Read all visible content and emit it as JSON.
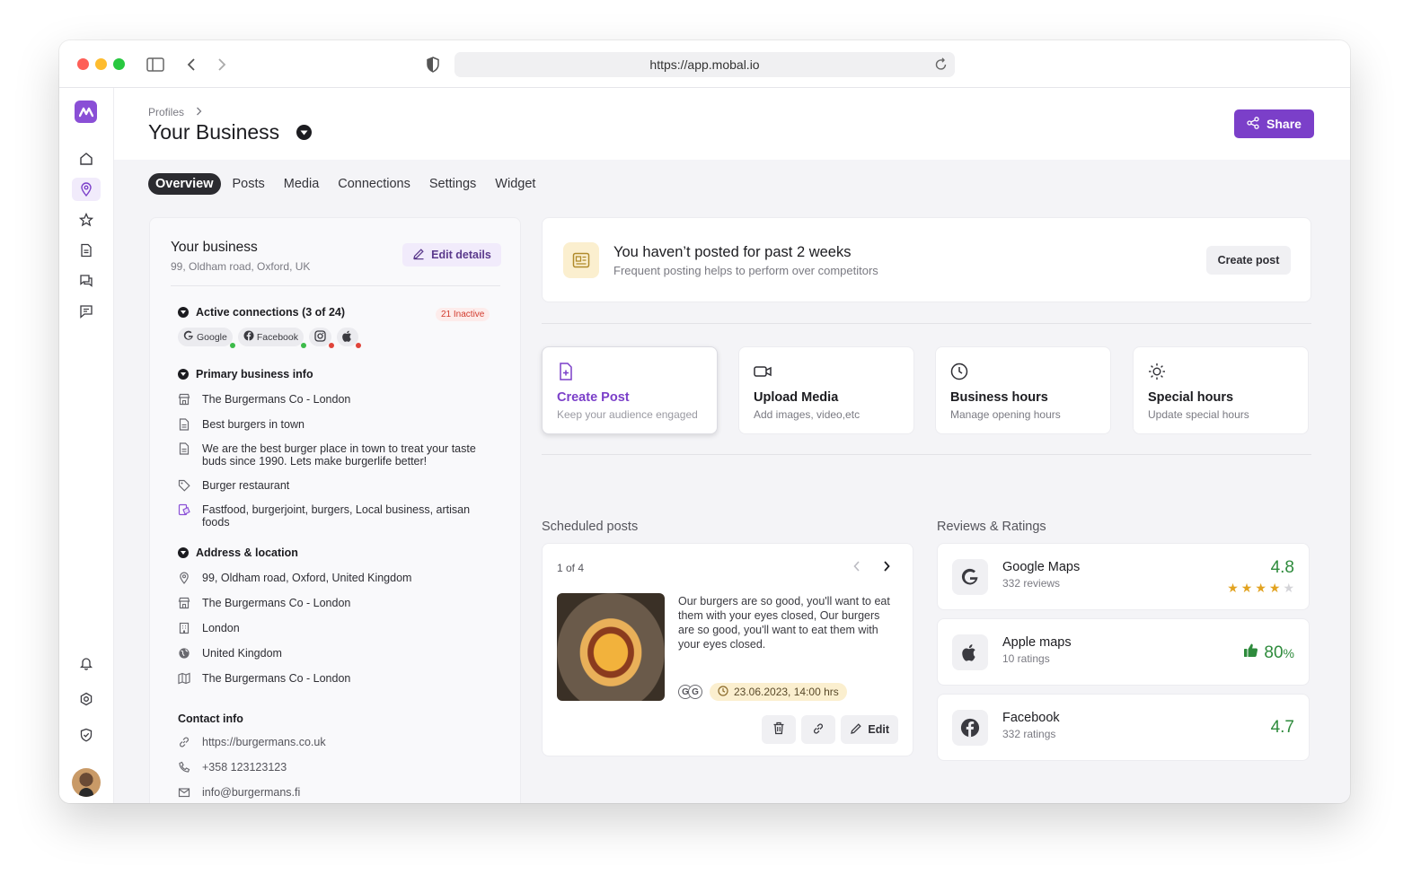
{
  "browser": {
    "url": "https://app.mobal.io"
  },
  "header": {
    "breadcrumb": "Profiles",
    "title": "Your Business",
    "share_label": "Share"
  },
  "tabs": [
    {
      "label": "Overview",
      "active": true
    },
    {
      "label": "Posts"
    },
    {
      "label": "Media"
    },
    {
      "label": "Connections"
    },
    {
      "label": "Settings"
    },
    {
      "label": "Widget"
    }
  ],
  "business": {
    "title": "Your business",
    "address": "99, Oldham road, Oxford, UK",
    "edit_label": "Edit details",
    "connections_heading": "Active connections (3 of 24)",
    "inactive_badge": "21 Inactive",
    "connections": [
      {
        "label": "Google",
        "icon": "google-icon",
        "status_color": "#3dbb4a"
      },
      {
        "label": "Facebook",
        "icon": "facebook-icon",
        "status_color": "#3dbb4a"
      },
      {
        "label": "",
        "icon": "instagram-icon",
        "status_color": "#e0443a"
      },
      {
        "label": "",
        "icon": "apple-icon",
        "status_color": "#e0443a"
      }
    ],
    "primary_heading": "Primary business info",
    "primary": [
      {
        "icon": "store-icon",
        "text": "The Burgermans Co - London"
      },
      {
        "icon": "document-icon",
        "text": "Best burgers in town"
      },
      {
        "icon": "document-icon",
        "text": "We are the best burger place in town to treat your taste buds since 1990. Lets make burgerlife better!"
      },
      {
        "icon": "tag-icon",
        "text": "Burger restaurant"
      },
      {
        "icon": "keywords-icon",
        "text": "Fastfood, burgerjoint, burgers, Local business, artisan foods"
      }
    ],
    "address_heading": "Address & location",
    "address_rows": [
      {
        "icon": "pin-icon",
        "text": "99, Oldham road, Oxford, United Kingdom"
      },
      {
        "icon": "store-icon",
        "text": "The Burgermans Co - London"
      },
      {
        "icon": "building-icon",
        "text": "London"
      },
      {
        "icon": "globe-icon",
        "text": "United Kingdom"
      },
      {
        "icon": "map-icon",
        "text": "The Burgermans Co - London"
      }
    ],
    "contact_heading": "Contact info",
    "contact_rows": [
      {
        "icon": "link-icon",
        "text": "https://burgermans.co.uk"
      },
      {
        "icon": "phone-icon",
        "text": "+358 123123123"
      },
      {
        "icon": "mail-icon",
        "text": "info@burgermans.fi"
      }
    ]
  },
  "banner": {
    "title": "You haven’t posted for past 2 weeks",
    "subtitle": "Frequent posting helps to perform over competitors",
    "button": "Create post"
  },
  "actions": [
    {
      "title": "Create Post",
      "subtitle": "Keep your audience engaged",
      "icon": "file-plus-icon",
      "selected": true
    },
    {
      "title": "Upload Media",
      "subtitle": "Add images, video,etc",
      "icon": "video-icon"
    },
    {
      "title": "Business hours",
      "subtitle": "Manage opening hours",
      "icon": "clock-icon"
    },
    {
      "title": "Special hours",
      "subtitle": "Update special hours",
      "icon": "sun-icon"
    }
  ],
  "scheduled": {
    "heading": "Scheduled posts",
    "pager": "1 of 4",
    "text": "Our burgers are so good, you'll want to eat them with your eyes closed, Our burgers are so good, you'll want to eat them with your eyes closed.",
    "date": "23.06.2023, 14:00 hrs",
    "edit_label": "Edit"
  },
  "reviews": {
    "heading": "Reviews & Ratings",
    "items": [
      {
        "name": "Google Maps",
        "count": "332 reviews",
        "score": "4.8",
        "stars": 4
      },
      {
        "name": "Apple maps",
        "count": "10 ratings",
        "percent": "80",
        "percent_sign": "%"
      },
      {
        "name": "Facebook",
        "count": "332 ratings",
        "score": "4.7"
      }
    ]
  },
  "colors": {
    "accent": "#7b3fc9",
    "positive": "#2e8b3c",
    "star": "#e2a321"
  }
}
